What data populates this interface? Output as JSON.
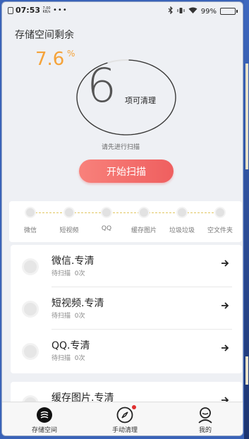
{
  "status_bar": {
    "time": "07:53",
    "net_speed_top": "7.00",
    "net_speed_unit": "KB/s",
    "dots": "•••",
    "battery": "99%"
  },
  "storage": {
    "title": "存储空间剩余",
    "percent": "7.6",
    "percent_sign": "%"
  },
  "cleaner": {
    "count": "6",
    "count_label": "项可清理",
    "hint": "请先进行扫描",
    "start_label": "开始扫描",
    "ring_progress": 0.93
  },
  "steps": [
    "微信",
    "短视频",
    "QQ",
    "缓存图片",
    "垃圾垃圾",
    "空文件夹"
  ],
  "list": [
    {
      "title": "微信.专清",
      "status": "待扫描",
      "count": "0次"
    },
    {
      "title": "短视频.专清",
      "status": "待扫描",
      "count": "0次"
    },
    {
      "title": "QQ.专清",
      "status": "待扫描",
      "count": "0次"
    },
    {
      "title": "缓存图片.专清"
    }
  ],
  "tabs": [
    {
      "label": "存储空间",
      "icon": "storage-icon"
    },
    {
      "label": "手动清理",
      "icon": "compass-icon"
    },
    {
      "label": "我的",
      "icon": "profile-icon"
    }
  ],
  "colors": {
    "accent": "#f5a33a",
    "button": "#ef5f5f",
    "badge": "#e03030"
  }
}
